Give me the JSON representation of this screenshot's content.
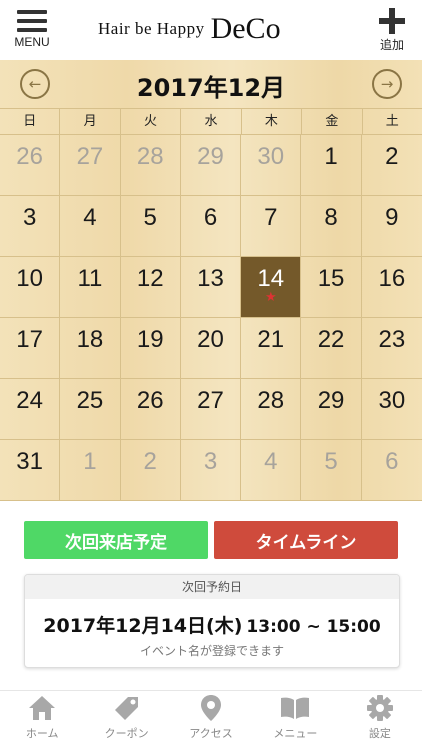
{
  "header": {
    "menu_label": "MENU",
    "logo_small": "Hair be Happy",
    "logo_big": "DeCo",
    "add_label": "追加"
  },
  "calendar": {
    "month_title": "2017年12月",
    "weekdays": [
      "日",
      "月",
      "火",
      "水",
      "木",
      "金",
      "土"
    ],
    "days": [
      {
        "label": "26",
        "current": false
      },
      {
        "label": "27",
        "current": false
      },
      {
        "label": "28",
        "current": false
      },
      {
        "label": "29",
        "current": false
      },
      {
        "label": "30",
        "current": false
      },
      {
        "label": "1",
        "current": true
      },
      {
        "label": "2",
        "current": true
      },
      {
        "label": "3",
        "current": true
      },
      {
        "label": "4",
        "current": true
      },
      {
        "label": "5",
        "current": true
      },
      {
        "label": "6",
        "current": true
      },
      {
        "label": "7",
        "current": true
      },
      {
        "label": "8",
        "current": true
      },
      {
        "label": "9",
        "current": true
      },
      {
        "label": "10",
        "current": true
      },
      {
        "label": "11",
        "current": true
      },
      {
        "label": "12",
        "current": true
      },
      {
        "label": "13",
        "current": true
      },
      {
        "label": "14",
        "current": true,
        "selected": true,
        "marked": true
      },
      {
        "label": "15",
        "current": true
      },
      {
        "label": "16",
        "current": true
      },
      {
        "label": "17",
        "current": true
      },
      {
        "label": "18",
        "current": true
      },
      {
        "label": "19",
        "current": true
      },
      {
        "label": "20",
        "current": true
      },
      {
        "label": "21",
        "current": true
      },
      {
        "label": "22",
        "current": true
      },
      {
        "label": "23",
        "current": true
      },
      {
        "label": "24",
        "current": true
      },
      {
        "label": "25",
        "current": true
      },
      {
        "label": "26",
        "current": true
      },
      {
        "label": "27",
        "current": true
      },
      {
        "label": "28",
        "current": true
      },
      {
        "label": "29",
        "current": true
      },
      {
        "label": "30",
        "current": true
      },
      {
        "label": "31",
        "current": true
      },
      {
        "label": "1",
        "current": false
      },
      {
        "label": "2",
        "current": false
      },
      {
        "label": "3",
        "current": false
      },
      {
        "label": "4",
        "current": false
      },
      {
        "label": "5",
        "current": false
      },
      {
        "label": "6",
        "current": false
      }
    ],
    "star_glyph": "★"
  },
  "actions": {
    "next_visit_label": "次回来店予定",
    "timeline_label": "タイムライン"
  },
  "reservation": {
    "header": "次回予約日",
    "date": "2017年12月14日(木)",
    "time": "13:00 ~ 15:00",
    "note": "イベント名が登録できます"
  },
  "bottom_nav": [
    {
      "label": "ホーム",
      "icon": "home-icon"
    },
    {
      "label": "クーポン",
      "icon": "tag-icon"
    },
    {
      "label": "アクセス",
      "icon": "map-pin-icon"
    },
    {
      "label": "メニュー",
      "icon": "book-icon"
    },
    {
      "label": "設定",
      "icon": "gear-icon"
    }
  ],
  "colors": {
    "accent_green": "#4fd866",
    "accent_red": "#cf4b3c",
    "selected_day": "#74592a",
    "calendar_bg": "#f0dcae",
    "star": "#dd3333"
  }
}
